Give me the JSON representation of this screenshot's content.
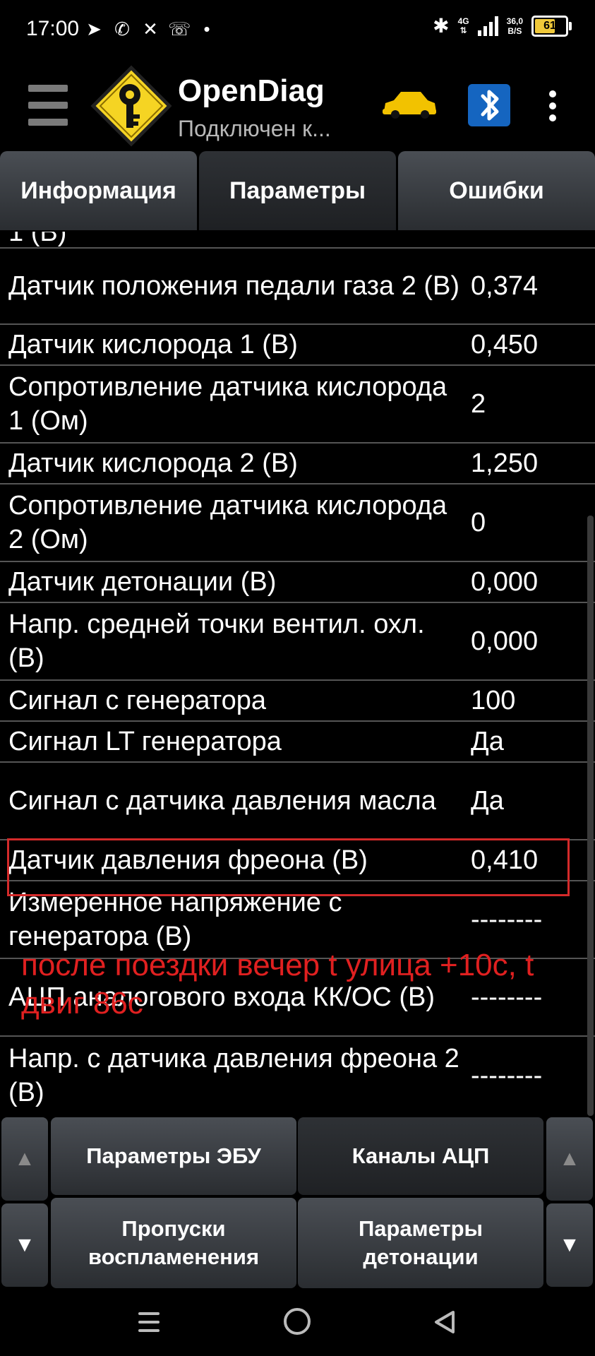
{
  "status_bar": {
    "time": "17:00",
    "app_icons": [
      "telegram-icon",
      "whatsapp-icon",
      "x-icon",
      "viber-icon",
      "dot-icon"
    ],
    "network_type": "4G",
    "network_speed_value": "36,0",
    "network_speed_unit": "B/S",
    "battery": "61"
  },
  "app_bar": {
    "title": "OpenDiag",
    "subtitle": "Подключен к...",
    "brand_colors": {
      "logo_yellow": "#f5d423",
      "car_yellow": "#f2c200",
      "bluetooth_blue": "#1565c0"
    }
  },
  "tabs": [
    {
      "label": "Информация",
      "active": false
    },
    {
      "label": "Параметры",
      "active": true
    },
    {
      "label": "Ошибки",
      "active": false
    }
  ],
  "params": [
    {
      "name": "1 (В)",
      "value": ""
    },
    {
      "name": "Датчик положения педали газа 2 (В)",
      "value": "0,374"
    },
    {
      "name": "Датчик кислорода 1 (В)",
      "value": "0,450"
    },
    {
      "name": "Сопротивление датчика кислорода 1 (Ом)",
      "value": "2"
    },
    {
      "name": "Датчик кислорода 2 (В)",
      "value": "1,250"
    },
    {
      "name": "Сопротивление датчика кислорода 2 (Ом)",
      "value": "0"
    },
    {
      "name": "Датчик детонации (В)",
      "value": "0,000"
    },
    {
      "name": "Напр. средней точки вентил. охл. (В)",
      "value": "0,000"
    },
    {
      "name": "Сигнал с генератора",
      "value": "100"
    },
    {
      "name": "Сигнал LT генератора",
      "value": "Да"
    },
    {
      "name": "Сигнал с датчика давления масла",
      "value": "Да"
    },
    {
      "name": "Датчик давления фреона (В)",
      "value": "0,410"
    },
    {
      "name": "Измеренное напряжение с генератора (В)",
      "value": "--------"
    },
    {
      "name": "АЦП аналогового входа КК/ОС (В)",
      "value": "--------"
    },
    {
      "name": "Напр. с датчика давления фреона 2 (В)",
      "value": "--------"
    }
  ],
  "annotation": {
    "text": "после поездки вечер t улица +10с, t двиг 86с",
    "color": "#e02020"
  },
  "bottom_buttons": {
    "up_arrow_left": "▲",
    "up_arrow_right": "▲",
    "down_arrow_left": "▼",
    "down_arrow_right": "▼",
    "ecu_params": "Параметры ЭБУ",
    "adc_channels": "Каналы АЦП",
    "misfires": "Пропуски воспламенения",
    "detonation_params": "Параметры детонации"
  },
  "nav_bar": {
    "icons": [
      "menu-icon",
      "home-icon",
      "back-icon"
    ]
  }
}
